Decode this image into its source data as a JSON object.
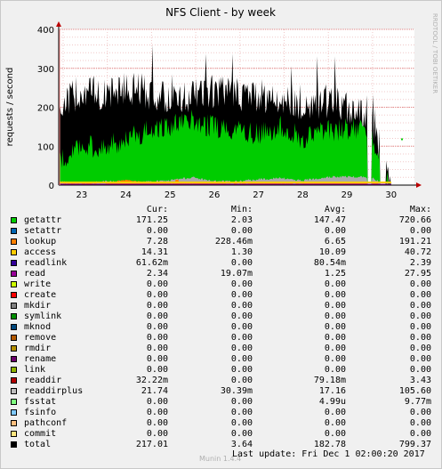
{
  "chart_data": {
    "type": "area",
    "title": "NFS Client - by week",
    "ylabel": "requests / second",
    "ylim": [
      0,
      400
    ],
    "yticks": [
      "0",
      "100",
      "200",
      "300",
      "400"
    ],
    "xticks": [
      "23",
      "24",
      "25",
      "26",
      "27",
      "28",
      "29",
      "30"
    ],
    "grid": true,
    "side_label": "RRDTOOL / TOBI OETIKER",
    "series": [
      {
        "name": "getattr",
        "color": "#00cc00",
        "values": [
          60,
          100,
          95,
          120,
          140,
          155,
          165,
          150,
          145,
          130,
          150,
          120,
          140,
          145,
          150,
          0
        ]
      },
      {
        "name": "readdirplus",
        "color": "#aaaaaa",
        "values": [
          8,
          6,
          9,
          10,
          8,
          12,
          20,
          10,
          9,
          15,
          18,
          12,
          20,
          22,
          21,
          0
        ]
      },
      {
        "name": "lookup",
        "color": "#ff8000",
        "values": [
          4,
          5,
          3,
          14,
          6,
          5,
          5,
          6,
          4,
          6,
          5,
          4,
          7,
          6,
          7,
          0
        ]
      },
      {
        "name": "total",
        "color": "#000000",
        "values": [
          200,
          245,
          230,
          250,
          240,
          215,
          230,
          240,
          235,
          230,
          220,
          200,
          215,
          200,
          190,
          0
        ]
      }
    ]
  },
  "legend": {
    "headers": {
      "cur": "Cur:",
      "min": "Min:",
      "avg": "Avg:",
      "max": "Max:"
    },
    "rows": [
      {
        "name": "getattr",
        "color": "#00cc00",
        "cur": "171.25",
        "min": "2.03",
        "avg": "147.47",
        "max": "720.66"
      },
      {
        "name": "setattr",
        "color": "#0066b3",
        "cur": "0.00",
        "min": "0.00",
        "avg": "0.00",
        "max": "0.00"
      },
      {
        "name": "lookup",
        "color": "#ff8000",
        "cur": "7.28",
        "min": "228.46m",
        "avg": "6.65",
        "max": "191.21"
      },
      {
        "name": "access",
        "color": "#ffcc00",
        "cur": "14.31",
        "min": "1.30",
        "avg": "10.09",
        "max": "40.72"
      },
      {
        "name": "readlink",
        "color": "#330099",
        "cur": "61.62m",
        "min": "0.00",
        "avg": "80.54m",
        "max": "2.39"
      },
      {
        "name": "read",
        "color": "#990099",
        "cur": "2.34",
        "min": "19.07m",
        "avg": "1.25",
        "max": "27.95"
      },
      {
        "name": "write",
        "color": "#ccff00",
        "cur": "0.00",
        "min": "0.00",
        "avg": "0.00",
        "max": "0.00"
      },
      {
        "name": "create",
        "color": "#ff0000",
        "cur": "0.00",
        "min": "0.00",
        "avg": "0.00",
        "max": "0.00"
      },
      {
        "name": "mkdir",
        "color": "#808080",
        "cur": "0.00",
        "min": "0.00",
        "avg": "0.00",
        "max": "0.00"
      },
      {
        "name": "symlink",
        "color": "#008f00",
        "cur": "0.00",
        "min": "0.00",
        "avg": "0.00",
        "max": "0.00"
      },
      {
        "name": "mknod",
        "color": "#00487d",
        "cur": "0.00",
        "min": "0.00",
        "avg": "0.00",
        "max": "0.00"
      },
      {
        "name": "remove",
        "color": "#b35a00",
        "cur": "0.00",
        "min": "0.00",
        "avg": "0.00",
        "max": "0.00"
      },
      {
        "name": "rmdir",
        "color": "#b38f00",
        "cur": "0.00",
        "min": "0.00",
        "avg": "0.00",
        "max": "0.00"
      },
      {
        "name": "rename",
        "color": "#6b006b",
        "cur": "0.00",
        "min": "0.00",
        "avg": "0.00",
        "max": "0.00"
      },
      {
        "name": "link",
        "color": "#8fb300",
        "cur": "0.00",
        "min": "0.00",
        "avg": "0.00",
        "max": "0.00"
      },
      {
        "name": "readdir",
        "color": "#b30000",
        "cur": "32.22m",
        "min": "0.00",
        "avg": "79.18m",
        "max": "3.43"
      },
      {
        "name": "readdirplus",
        "color": "#bebebe",
        "cur": "21.74",
        "min": "30.39m",
        "avg": "17.16",
        "max": "105.60"
      },
      {
        "name": "fsstat",
        "color": "#80ff80",
        "cur": "0.00",
        "min": "0.00",
        "avg": "4.99u",
        "max": "9.77m"
      },
      {
        "name": "fsinfo",
        "color": "#80c9ff",
        "cur": "0.00",
        "min": "0.00",
        "avg": "0.00",
        "max": "0.00"
      },
      {
        "name": "pathconf",
        "color": "#ffc080",
        "cur": "0.00",
        "min": "0.00",
        "avg": "0.00",
        "max": "0.00"
      },
      {
        "name": "commit",
        "color": "#ffe680",
        "cur": "0.00",
        "min": "0.00",
        "avg": "0.00",
        "max": "0.00"
      },
      {
        "name": "total",
        "color": "#000000",
        "cur": "217.01",
        "min": "3.64",
        "avg": "182.78",
        "max": "799.37"
      }
    ]
  },
  "footer": {
    "version": "Munin 1.4.4",
    "last_update": "Last update:  Fri Dec  1 02:00:20 2017"
  }
}
